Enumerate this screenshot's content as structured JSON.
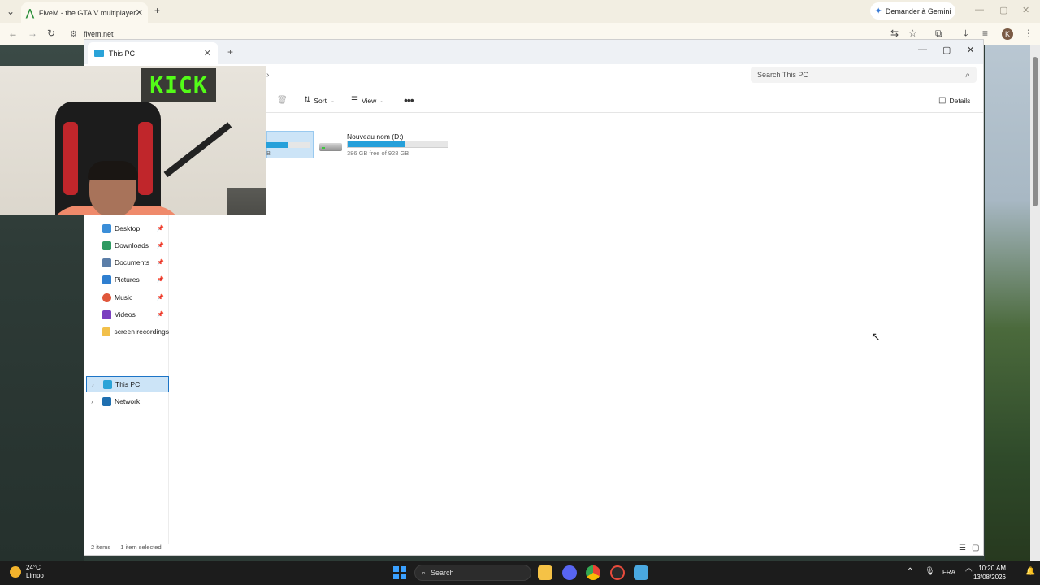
{
  "browser": {
    "tab_title": "FiveM - the GTA V multiplayer",
    "address": "fivem.net",
    "gemini_label": "Demander à Gemini",
    "avatar_letter": "K"
  },
  "explorer": {
    "tab_title": "This PC",
    "search_placeholder": "Search This PC",
    "toolbar": {
      "sort": "Sort",
      "view": "View",
      "details": "Details"
    },
    "drive_c": {
      "free_text_partial": "B",
      "used_fraction": 0.5
    },
    "drive_d": {
      "name": "Nouveau nom (D:)",
      "free_text": "386 GB free of 928 GB",
      "used_fraction": 0.58
    },
    "sidebar": {
      "pinned": [
        {
          "label": "Desktop",
          "icon": "desktop-icon",
          "color": "#3b8ed8",
          "pinned": true
        },
        {
          "label": "Downloads",
          "icon": "download-icon",
          "color": "#2e9a62",
          "pinned": true
        },
        {
          "label": "Documents",
          "icon": "document-icon",
          "color": "#5b7ea8",
          "pinned": true
        },
        {
          "label": "Pictures",
          "icon": "picture-icon",
          "color": "#2f7fd0",
          "pinned": true
        },
        {
          "label": "Music",
          "icon": "music-icon",
          "color": "#e0573b",
          "pinned": true
        },
        {
          "label": "Videos",
          "icon": "video-icon",
          "color": "#7a3fc0",
          "pinned": true
        },
        {
          "label": "screen recordings",
          "icon": "folder-icon",
          "color": "#f2c04a",
          "pinned": false
        }
      ],
      "this_pc": "This PC",
      "network": "Network"
    },
    "status": {
      "items": "2 items",
      "selected": "1 item selected"
    }
  },
  "webcam": {
    "sign_text": "KICK"
  },
  "taskbar": {
    "temperature": "24°C",
    "condition": "Limpo",
    "search_placeholder": "Search",
    "language": "FRA",
    "time": "10:20 AM",
    "date": "13/08/2026"
  }
}
